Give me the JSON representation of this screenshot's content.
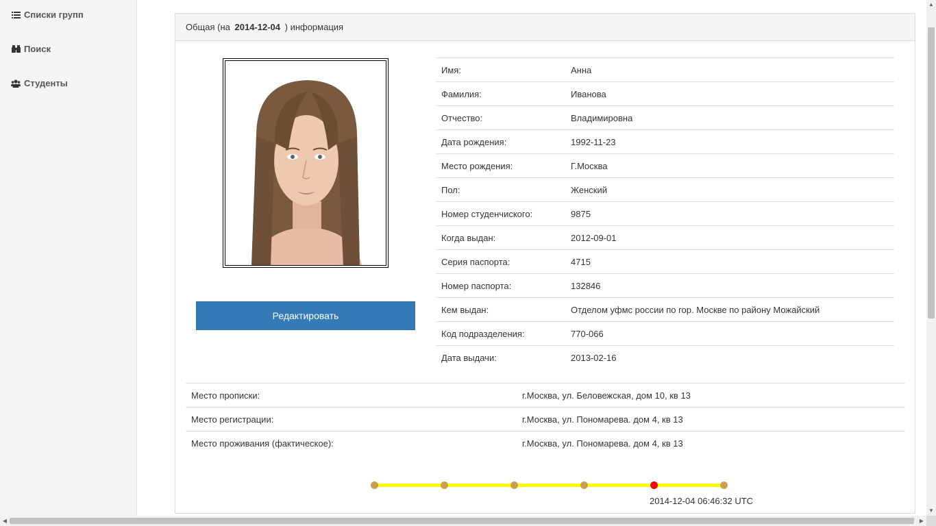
{
  "sidebar": {
    "items": [
      {
        "label": "Списки групп",
        "icon": "list-icon"
      },
      {
        "label": "Поиск",
        "icon": "binoculars-icon"
      },
      {
        "label": "Студенты",
        "icon": "users-icon"
      }
    ]
  },
  "panel": {
    "heading_prefix": "Общая (на",
    "heading_date": "2014-12-04",
    "heading_suffix": ") информация"
  },
  "edit_button": "Редактировать",
  "info": [
    {
      "label": "Имя:",
      "value": "Анна"
    },
    {
      "label": "Фамилия:",
      "value": "Иванова"
    },
    {
      "label": "Отчество:",
      "value": "Владимировна"
    },
    {
      "label": "Дата рождения:",
      "value": "1992-11-23"
    },
    {
      "label": "Место рождения:",
      "value": "Г.Москва"
    },
    {
      "label": "Пол:",
      "value": "Женский"
    },
    {
      "label": "Номер студенчиского:",
      "value": "9875"
    },
    {
      "label": "Когда выдан:",
      "value": "2012-09-01"
    },
    {
      "label": "Серия паспорта:",
      "value": "4715"
    },
    {
      "label": "Номер паспорта:",
      "value": "132846"
    },
    {
      "label": "Кем выдан:",
      "value": "Отделом уфмс россии по гор. Москве по району Можайский"
    },
    {
      "label": "Код подразделения:",
      "value": "770-066"
    },
    {
      "label": "Дата выдачи:",
      "value": "2013-02-16"
    }
  ],
  "addresses": [
    {
      "label": "Место прописки:",
      "value": "г.Москва, ул. Беловежская, дом 10, кв 13"
    },
    {
      "label": "Место регистрации:",
      "value": "г.Москва, ул. Пономарева. дом 4, кв 13"
    },
    {
      "label": "Место проживания (фактическое):",
      "value": "г.Москва, ул. Пономарева. дом 4, кв 13"
    }
  ],
  "timeline": {
    "point_count": 6,
    "active_index": 4,
    "line_color": "#ffff00",
    "dot_color": "#c8a050",
    "active_color": "#ff0000",
    "timestamp": "2014-12-04 06:46:32 UTC"
  }
}
